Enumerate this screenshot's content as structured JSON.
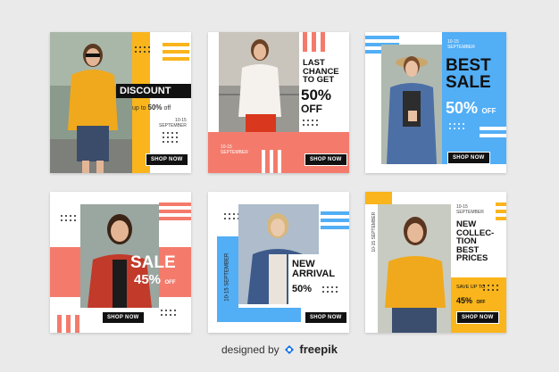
{
  "colors": {
    "orange": "#f9b51b",
    "coral": "#f47b6c",
    "blue": "#52aef5",
    "dark": "#111111",
    "bg": "#eaeaea"
  },
  "cards": [
    {
      "headline": "DISCOUNT",
      "offer_prefix": "up to",
      "offer_value": "50%",
      "offer_suffix": "off",
      "date": "10-15",
      "month": "SEPTEMBER",
      "cta": "SHOP NOW"
    },
    {
      "headline_1": "LAST",
      "headline_2": "CHANCE",
      "headline_3": "TO GET",
      "percent": "50%",
      "off": "OFF",
      "date": "10-15",
      "month": "SEPTEMBER",
      "cta": "SHOP NOW"
    },
    {
      "date": "10-15",
      "month": "SEPTEMBER",
      "headline_1": "BEST",
      "headline_2": "SALE",
      "percent": "50%",
      "off": "OFF",
      "cta": "SHOP NOW"
    },
    {
      "headline": "SALE",
      "percent": "45%",
      "off": "OFF",
      "cta": "SHOP NOW"
    },
    {
      "vertical_date": "10-15 SEPTEMBER",
      "headline_1": "NEW",
      "headline_2": "ARRIVAL",
      "percent": "50%",
      "cta": "SHOP NOW"
    },
    {
      "vertical_date": "10-15 SEPTEMBER",
      "date": "10-15",
      "month": "SEPTEMBER",
      "headline_1": "NEW",
      "headline_2": "COLLEC-",
      "headline_3": "TION",
      "headline_4": "BEST",
      "headline_5": "PRICES",
      "offer_prefix": "SAVE UP TO",
      "percent": "45%",
      "off": "OFF",
      "cta": "SHOP NOW"
    }
  ],
  "footer": {
    "text": "designed by",
    "brand": "freepik"
  }
}
